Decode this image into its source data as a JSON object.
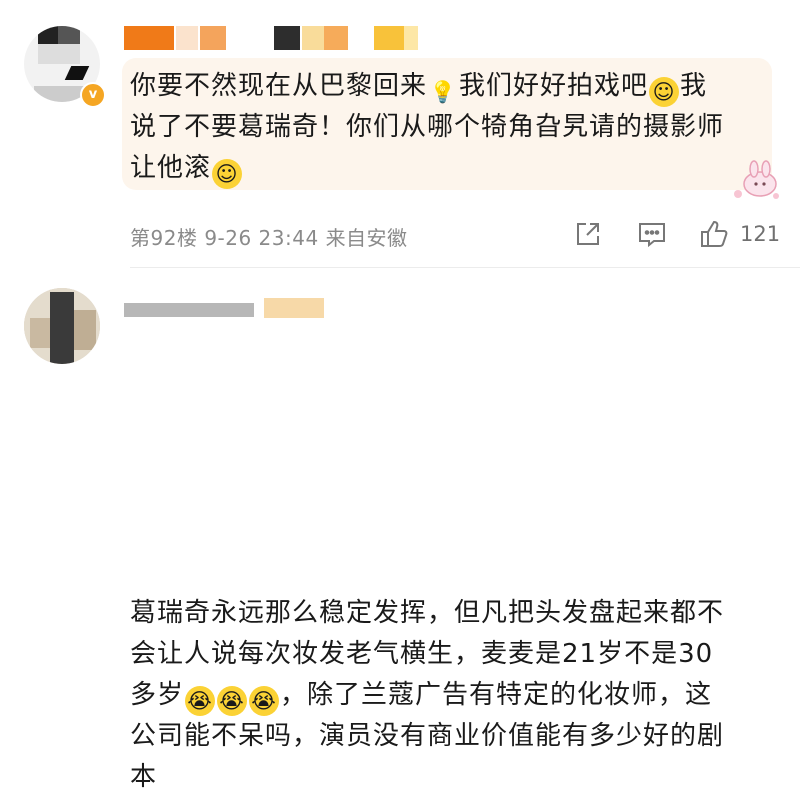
{
  "comments": [
    {
      "text_line1": "你要不然现在从巴黎回来",
      "text_line1b": "我们好好拍戏吧",
      "text_line1c": "我",
      "text_line2": "说了不要葛瑞奇！你们从哪个犄角旮旯请的摄影师",
      "text_line3": "让他滚",
      "floor": "第92楼",
      "time": "9-26 23:44",
      "location": "来自安徽",
      "likes": "121",
      "icons": [
        "verified-badge-icon",
        "share-icon",
        "reply-icon",
        "like-icon"
      ]
    },
    {
      "text_line1": "葛瑞奇永远那么稳定发挥，但凡把头发盘起来都不",
      "text_line2": "会让人说每次妆发老气横生，麦麦是21岁不是30",
      "text_line3a": "多岁",
      "text_line3b": "，除了兰蔻广告有特定的化妆师，这",
      "text_line4": "公司能不呆吗，演员没有商业价值能有多少好的剧",
      "text_line5": "本"
    }
  ],
  "colors": {
    "bubble": "#fdf5ec",
    "meta": "#8a8a8a",
    "badge": "#f5a623"
  }
}
